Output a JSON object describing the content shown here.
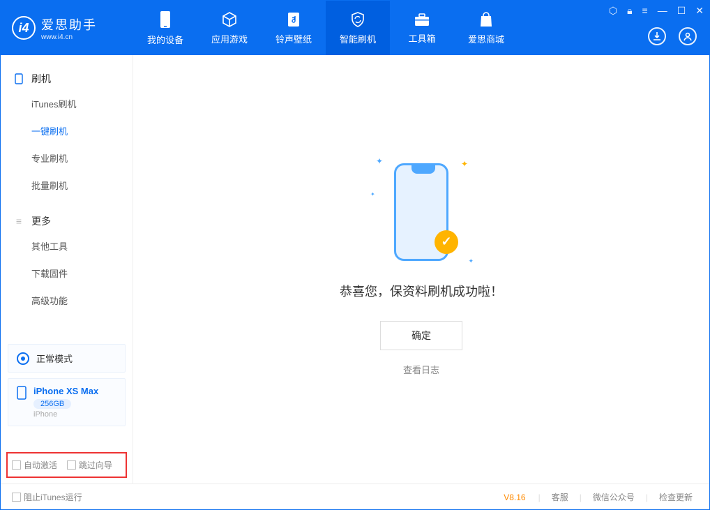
{
  "app": {
    "title": "爱思助手",
    "subtitle": "www.i4.cn"
  },
  "nav": {
    "tabs": [
      {
        "label": "我的设备"
      },
      {
        "label": "应用游戏"
      },
      {
        "label": "铃声壁纸"
      },
      {
        "label": "智能刷机"
      },
      {
        "label": "工具箱"
      },
      {
        "label": "爱思商城"
      }
    ]
  },
  "sidebar": {
    "group1": {
      "title": "刷机",
      "items": [
        {
          "label": "iTunes刷机"
        },
        {
          "label": "一键刷机"
        },
        {
          "label": "专业刷机"
        },
        {
          "label": "批量刷机"
        }
      ]
    },
    "group2": {
      "title": "更多",
      "items": [
        {
          "label": "其他工具"
        },
        {
          "label": "下载固件"
        },
        {
          "label": "高级功能"
        }
      ]
    },
    "mode_label": "正常模式",
    "device": {
      "name": "iPhone XS Max",
      "capacity": "256GB",
      "type": "iPhone"
    },
    "opt_auto_activate": "自动激活",
    "opt_skip_guide": "跳过向导"
  },
  "main": {
    "success_text": "恭喜您，保资料刷机成功啦！",
    "ok_button": "确定",
    "view_log": "查看日志"
  },
  "footer": {
    "block_itunes": "阻止iTunes运行",
    "version": "V8.16",
    "links": {
      "support": "客服",
      "wechat": "微信公众号",
      "update": "检查更新"
    }
  }
}
